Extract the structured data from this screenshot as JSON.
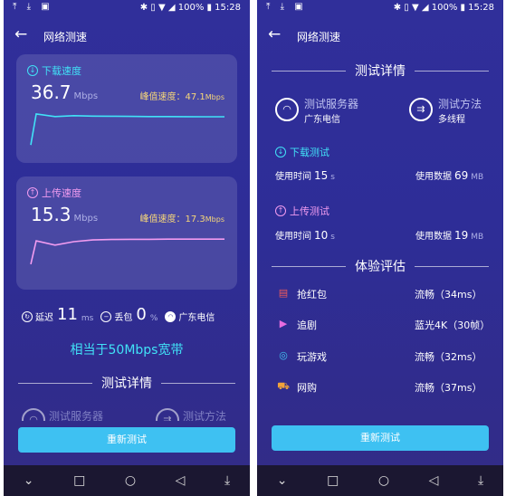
{
  "status": {
    "left_icons": "⤒ ⤓ ▣",
    "right_text": "✱ ▯ ▼ ◢ 100% ▮ 15:28"
  },
  "titlebar": {
    "back": "←",
    "title": "网络测速"
  },
  "download": {
    "label": "下载速度",
    "speed": "36.7",
    "unit": "Mbps",
    "peak_label": "峰值速度：47.1",
    "peak_unit": "Mbps",
    "line_color": "#41e2f7",
    "chart_data": {
      "type": "line",
      "values": [
        4,
        40,
        37,
        38,
        37.5,
        37.4,
        37.2,
        37,
        37,
        36.9,
        36.8,
        36.7
      ]
    }
  },
  "upload": {
    "label": "上传速度",
    "speed": "15.3",
    "unit": "Mbps",
    "peak_label": "峰值速度：17.3",
    "peak_unit": "Mbps",
    "line_color": "#f29cf0",
    "chart_data": {
      "type": "line",
      "values": [
        3,
        14,
        12,
        13.6,
        14.4,
        14.6,
        14.7,
        14.7,
        14.8,
        14.8,
        14.8,
        14.8
      ]
    }
  },
  "stats": {
    "delay_label": "延迟",
    "delay_value": "11",
    "delay_unit": "ms",
    "loss_label": "丢包",
    "loss_value": "0",
    "loss_unit": "%",
    "isp": "广东电信"
  },
  "equivalent": "相当于50Mbps宽带",
  "section_detail": "测试详情",
  "section_experience": "体验评估",
  "server": {
    "label": "测试服务器",
    "value": "广东电信"
  },
  "method": {
    "label": "测试方法",
    "value": "多线程"
  },
  "detail_download": {
    "title": "下载测试",
    "time_label": "使用时间",
    "time": "15",
    "time_unit": "s",
    "data_label": "使用数据",
    "data": "69",
    "data_unit": "MB"
  },
  "detail_upload": {
    "title": "上传测试",
    "time_label": "使用时间",
    "time": "10",
    "time_unit": "s",
    "data_label": "使用数据",
    "data": "19",
    "data_unit": "MB"
  },
  "experience": [
    {
      "icon": "red-packet-icon",
      "name": "抢红包",
      "value": "流畅（34ms）",
      "color": "#ef5a5a"
    },
    {
      "icon": "video-icon",
      "name": "追剧",
      "value": "蓝光4K（30帧）",
      "color": "#e86ce0"
    },
    {
      "icon": "gamepad-icon",
      "name": "玩游戏",
      "value": "流畅（32ms）",
      "color": "#42c8f2"
    },
    {
      "icon": "cart-icon",
      "name": "网购",
      "value": "流畅（37ms）",
      "color": "#f2a33a"
    }
  ],
  "retest": "重新测试",
  "nav": {
    "down": "⌄",
    "square": "□",
    "circle": "○",
    "back": "◁",
    "menu": "⤓"
  }
}
